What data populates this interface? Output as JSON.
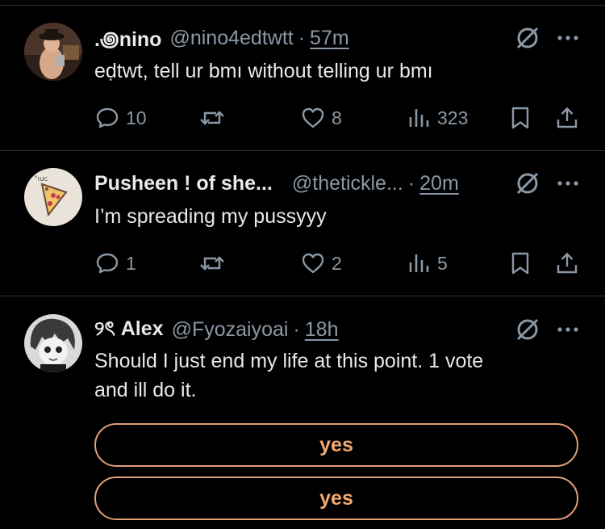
{
  "posts": [
    {
      "name": ".꩜nino",
      "handle": "@nino4edtwtt",
      "time": "57m",
      "text": "eḍtwt, tell ur bmı without telling ur bmı",
      "replies": "10",
      "likes": "8",
      "views": "323"
    },
    {
      "name": "Pusheen ! of she...",
      "handle": "@thetickle...",
      "time": "20m",
      "text": "I’m spreading my pussyyy",
      "replies": "1",
      "likes": "2",
      "views": "5"
    },
    {
      "name": "୨ৎ Alex",
      "handle": "@Fyozaiyoai",
      "time": "18h",
      "text_line1": "Should I just end my life at this point. 1 vote",
      "text_line2": "and ill do it.",
      "poll_options": [
        "yes",
        "yes"
      ]
    }
  ],
  "separator": "·",
  "icons": {
    "grok": "slashed-circle-icon",
    "more": "more-dots-icon",
    "reply": "reply-bubble-icon",
    "repost": "repost-arrows-icon",
    "like": "heart-icon",
    "views": "views-bars-icon",
    "bookmark": "bookmark-icon",
    "share": "share-icon"
  },
  "colors": {
    "background": "#000000",
    "text": "#e7e9ea",
    "secondary": "#8b98a5",
    "divider": "#2f3336",
    "poll_accent": "#f0a870"
  }
}
